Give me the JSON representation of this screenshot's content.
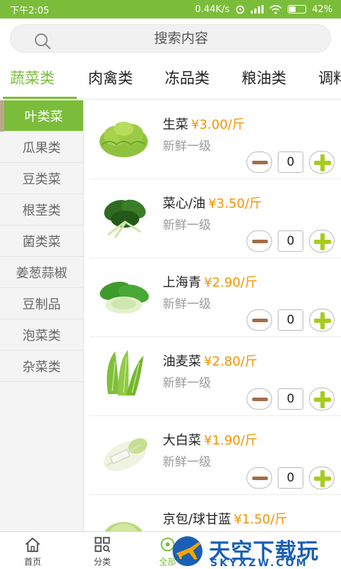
{
  "status": {
    "time": "下午2:05",
    "speed": "0.44K/s",
    "battery": "42%",
    "battery_level": 0.42
  },
  "search": {
    "placeholder": "搜索内容"
  },
  "tabs": [
    {
      "label": "蔬菜类",
      "active": true
    },
    {
      "label": "肉禽类",
      "active": false
    },
    {
      "label": "冻品类",
      "active": false
    },
    {
      "label": "粮油类",
      "active": false
    },
    {
      "label": "调料",
      "active": false
    }
  ],
  "sidebar": {
    "items": [
      {
        "label": "叶类菜",
        "active": true
      },
      {
        "label": "瓜果类",
        "active": false
      },
      {
        "label": "豆类菜",
        "active": false
      },
      {
        "label": "根茎类",
        "active": false
      },
      {
        "label": "菌类菜",
        "active": false
      },
      {
        "label": "姜葱蒜椒",
        "active": false
      },
      {
        "label": "豆制品",
        "active": false
      },
      {
        "label": "泡菜类",
        "active": false
      },
      {
        "label": "杂菜类",
        "active": false
      }
    ]
  },
  "products": [
    {
      "name": "生菜",
      "price": "¥3.00/斤",
      "grade": "新鲜一级",
      "qty": "0"
    },
    {
      "name": "菜心/油",
      "price": "¥3.50/斤",
      "grade": "新鲜一级",
      "qty": "0"
    },
    {
      "name": "上海青",
      "price": "¥2.90/斤",
      "grade": "新鲜一级",
      "qty": "0"
    },
    {
      "name": "油麦菜",
      "price": "¥2.80/斤",
      "grade": "新鲜一级",
      "qty": "0"
    },
    {
      "name": "大白菜",
      "price": "¥1.90/斤",
      "grade": "新鲜一级",
      "qty": "0"
    },
    {
      "name": "京包/球甘蓝",
      "price": "¥1.50/斤",
      "grade": "",
      "qty": ""
    }
  ],
  "bottom_nav": [
    {
      "label": "首页",
      "icon": "home-icon"
    },
    {
      "label": "分类",
      "icon": "category-icon"
    },
    {
      "label": "全部",
      "icon": "all-icon"
    }
  ],
  "watermark": {
    "text": "天空下载玩",
    "url": "SKYXZW.COM"
  },
  "colors": {
    "accent": "#7bbd3a",
    "price": "#f29400",
    "watermark": "#1a5fb4"
  }
}
